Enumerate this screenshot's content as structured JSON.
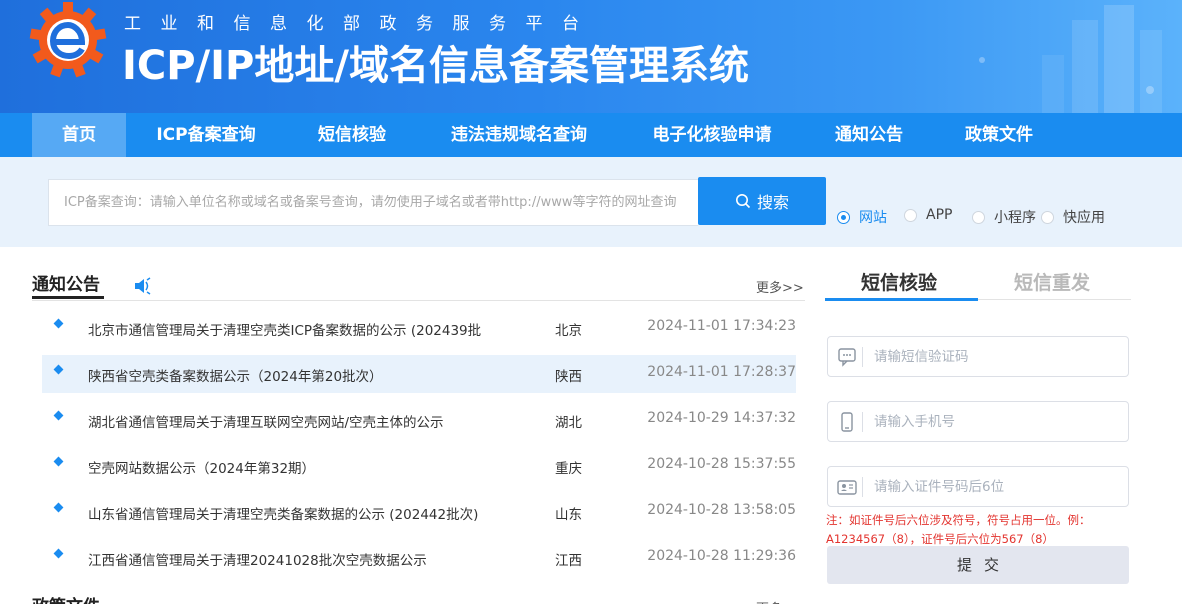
{
  "header": {
    "subtitle": "工业和信息化部政务服务平台",
    "title": "ICP/IP地址/域名信息备案管理系统"
  },
  "nav": {
    "items": [
      {
        "label": "首页",
        "active": true
      },
      {
        "label": "ICP备案查询"
      },
      {
        "label": "短信核验"
      },
      {
        "label": "违法违规域名查询"
      },
      {
        "label": "电子化核验申请"
      },
      {
        "label": "通知公告"
      },
      {
        "label": "政策文件"
      }
    ]
  },
  "search": {
    "placeholder": "ICP备案查询：请输入单位名称或域名或备案号查询，请勿使用子域名或者带http://www等字符的网址查询",
    "button_label": "搜索",
    "options": [
      {
        "label": "网站",
        "checked": true
      },
      {
        "label": "APP"
      },
      {
        "label": "小程序"
      },
      {
        "label": "快应用"
      }
    ]
  },
  "notices": {
    "title": "通知公告",
    "more_label": "更多>>",
    "items": [
      {
        "title": "北京市通信管理局关于清理空壳类ICP备案数据的公示 (202439批",
        "province": "北京",
        "date": "2024-11-01 17:34:23"
      },
      {
        "title": "陕西省空壳类备案数据公示（2024年第20批次）",
        "province": "陕西",
        "date": "2024-11-01 17:28:37"
      },
      {
        "title": "湖北省通信管理局关于清理互联网空壳网站/空壳主体的公示",
        "province": "湖北",
        "date": "2024-10-29 14:37:32"
      },
      {
        "title": "空壳网站数据公示（2024年第32期）",
        "province": "重庆",
        "date": "2024-10-28 15:37:55"
      },
      {
        "title": "山东省通信管理局关于清理空壳类备案数据的公示 (202442批次)",
        "province": "山东",
        "date": "2024-10-28 13:58:05"
      },
      {
        "title": "江西省通信管理局关于清理20241028批次空壳数据公示",
        "province": "江西",
        "date": "2024-10-28 11:29:36"
      }
    ]
  },
  "policy": {
    "title": "政策文件",
    "more_label": "更多"
  },
  "sms": {
    "tabs": [
      {
        "label": "短信核验",
        "active": true
      },
      {
        "label": "短信重发"
      }
    ],
    "fields": [
      {
        "placeholder": "请输短信验证码",
        "icon": "sms-icon"
      },
      {
        "placeholder": "请输入手机号",
        "icon": "phone-icon"
      },
      {
        "placeholder": "请输入证件号码后6位",
        "icon": "id-card-icon"
      }
    ],
    "note": "注：如证件号后六位涉及符号，符号占用一位。例：A1234567（8），证件号后六位为567（8）",
    "submit_label": "提交"
  },
  "colors": {
    "primary": "#1a8cf0",
    "header_dark": "#1f6fdc",
    "nav_active": "#56a9f4",
    "search_band": "#e8f2fc",
    "note_red": "#e3342f"
  }
}
